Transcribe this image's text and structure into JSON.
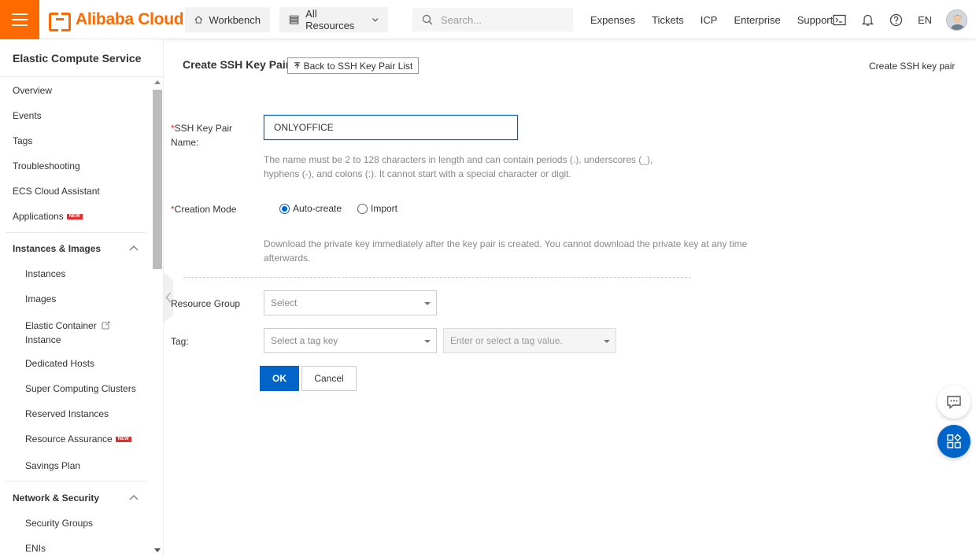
{
  "header": {
    "brand": "Alibaba Cloud",
    "workbench": "Workbench",
    "all_resources": "All Resources",
    "search_placeholder": "Search...",
    "links": [
      "Expenses",
      "Tickets",
      "ICP",
      "Enterprise",
      "Support"
    ],
    "language": "EN"
  },
  "sidebar": {
    "title": "Elastic Compute Service",
    "items": [
      "Overview",
      "Events",
      "Tags",
      "Troubleshooting",
      "ECS Cloud Assistant",
      "Applications"
    ],
    "new_badge": "NEW",
    "sections": {
      "instances_images": {
        "label": "Instances & Images",
        "items": [
          "Instances",
          "Images",
          "Elastic Container",
          "Instance",
          "Dedicated Hosts",
          "Super Computing Clusters",
          "Reserved Instances",
          "Resource Assurance",
          "Savings Plan"
        ]
      },
      "network_security": {
        "label": "Network & Security",
        "items": [
          "Security Groups",
          "ENIs"
        ]
      }
    }
  },
  "main": {
    "title": "Create SSH Key Pair",
    "back_button": "Back to SSH Key Pair List",
    "top_right_link": "Create SSH key pair",
    "form": {
      "required_mark": "*",
      "name_label_line1": "SSH Key Pair",
      "name_label_line2": "Name:",
      "name_value": "ONLYOFFICE",
      "name_hint_line1": "The name must be 2 to 128 characters in length and can contain periods (.), underscores (_),",
      "name_hint_line2": "hyphens (-), and colons (:). It cannot start with a special character or digit.",
      "mode_label": "Creation Mode",
      "mode_options": [
        "Auto-create",
        "Import"
      ],
      "mode_selected": "Auto-create",
      "mode_hint_line1": "Download the private key immediately after the key pair is created. You cannot download the private key at any time",
      "mode_hint_line2": "afterwards.",
      "resource_group_label": "Resource Group",
      "resource_group_placeholder": "Select",
      "tag_label": "Tag:",
      "tag_key_placeholder": "Select a tag key",
      "tag_value_placeholder": "Enter or select a tag value.",
      "ok": "OK",
      "cancel": "Cancel"
    }
  },
  "colors": {
    "brand_orange": "#ff6a00",
    "primary_blue": "#0064c8",
    "required_red": "#d93026",
    "new_badge_red": "#e62e2e"
  }
}
